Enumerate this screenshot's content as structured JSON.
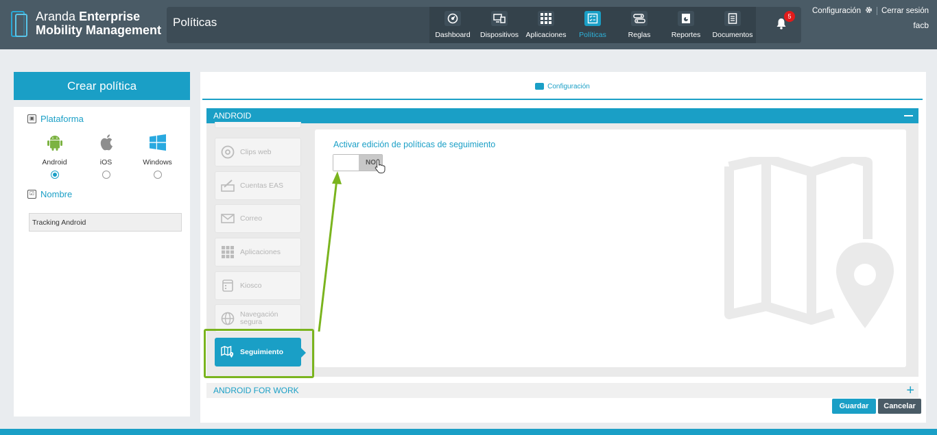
{
  "header": {
    "brand_light": "Aranda",
    "brand_bold": "Enterprise",
    "brand_line2": "Mobility Management",
    "section_title": "Políticas",
    "nav": [
      {
        "label": "Dashboard",
        "icon": "dashboard-icon"
      },
      {
        "label": "Dispositivos",
        "icon": "devices-icon"
      },
      {
        "label": "Aplicaciones",
        "icon": "apps-grid-icon"
      },
      {
        "label": "Políticas",
        "icon": "policies-icon",
        "active": true
      },
      {
        "label": "Reglas",
        "icon": "rules-icon"
      },
      {
        "label": "Reportes",
        "icon": "reports-icon"
      },
      {
        "label": "Documentos",
        "icon": "documents-icon"
      }
    ],
    "notifications_count": "5",
    "settings_label": "Configuración",
    "logout_label": "Cerrar sesión",
    "username": "facb"
  },
  "left_panel": {
    "title": "Crear política",
    "platform_label": "Plataforma",
    "platforms": [
      {
        "name": "Android",
        "selected": true
      },
      {
        "name": "iOS",
        "selected": false
      },
      {
        "name": "Windows",
        "selected": false
      }
    ],
    "name_label": "Nombre",
    "name_value": "Tracking Android"
  },
  "main": {
    "config_tab_label": "Configuración",
    "android_section_label": "ANDROID",
    "menu": [
      {
        "label": "Clips web",
        "icon": "clips-web-icon"
      },
      {
        "label": "Cuentas EAS",
        "icon": "eas-accounts-icon"
      },
      {
        "label": "Correo",
        "icon": "mail-icon"
      },
      {
        "label": "Aplicaciones",
        "icon": "apps-grid-icon"
      },
      {
        "label": "Kiosco",
        "icon": "kiosk-icon"
      },
      {
        "label": "Navegación segura",
        "icon": "globe-icon"
      },
      {
        "label": "Seguimiento",
        "icon": "map-pin-icon",
        "active": true
      }
    ],
    "tracking_toggle_label": "Activar edición de políticas de seguimiento",
    "tracking_toggle_value": "NO",
    "android_for_work_label": "ANDROID FOR WORK",
    "save_label": "Guardar",
    "cancel_label": "Cancelar"
  },
  "colors": {
    "accent": "#1a9fc6",
    "header": "#4a5b66",
    "highlight": "#7ab41e",
    "badge": "#e21b1b"
  }
}
